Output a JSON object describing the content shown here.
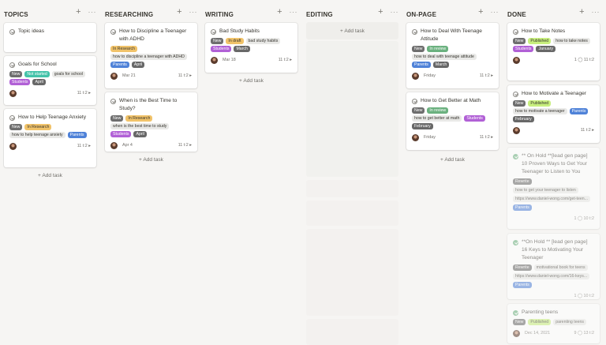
{
  "columns": [
    {
      "title": "TOPICS",
      "add_task": "+ Add task",
      "cards": [
        {
          "title": "Topic ideas"
        },
        {
          "title": "Goals for School",
          "tags": [
            {
              "t": "New"
            },
            {
              "t": "Not started"
            },
            {
              "t": "goals for school"
            },
            {
              "t": "Students"
            },
            {
              "t": "April"
            }
          ],
          "date": "",
          "time": "11 t:2 ▸"
        },
        {
          "title": "How to Help Teenage Anxiety",
          "tags": [
            {
              "t": "New"
            },
            {
              "t": "In Research"
            },
            {
              "t": "how to help teenage anxiety"
            },
            {
              "t": "Parents"
            }
          ],
          "date": "",
          "time": "11 t:2 ▸"
        }
      ]
    },
    {
      "title": "RESEARCHING",
      "add_task": "+ Add task",
      "cards": [
        {
          "title": "How to Discipline a Teenager with ADHD",
          "tags": [
            {
              "t": "In Research"
            },
            {
              "t": "how to discipline a teenager with ADHD"
            },
            {
              "t": "Parents"
            },
            {
              "t": "April"
            }
          ],
          "date": "Mar 21",
          "time": "11 t:2 ▸"
        },
        {
          "title": "When is the Best Time to Study?",
          "tags": [
            {
              "t": "New"
            },
            {
              "t": "In Research"
            },
            {
              "t": "when is the best time to study"
            },
            {
              "t": "Students"
            },
            {
              "t": "April"
            }
          ],
          "date": "Apr 4",
          "time": "11 t:2 ▸"
        }
      ]
    },
    {
      "title": "WRITING",
      "add_task": "+ Add task",
      "cards": [
        {
          "title": "Bad Study Habits",
          "tags": [
            {
              "t": "New"
            },
            {
              "t": "In draft"
            },
            {
              "t": "bad study habits"
            },
            {
              "t": "Students"
            },
            {
              "t": "March"
            }
          ],
          "date": "Mar 18",
          "time": "11 t:2 ▸"
        }
      ]
    },
    {
      "title": "EDITING",
      "add_task": "+ Add task",
      "cards": []
    },
    {
      "title": "ON-PAGE",
      "add_task": "+ Add task",
      "cards": [
        {
          "title": "How to Deal With Teenage Attitude",
          "tags": [
            {
              "t": "New"
            },
            {
              "t": "In review"
            },
            {
              "t": "how to deal with teenage attitude"
            },
            {
              "t": "Parents"
            },
            {
              "t": "March"
            }
          ],
          "date": "Friday",
          "time": "11 t:2 ▸"
        },
        {
          "title": "How to Get Better at Math",
          "tags": [
            {
              "t": "New"
            },
            {
              "t": "In review"
            },
            {
              "t": "how to get better at math"
            },
            {
              "t": "Students"
            },
            {
              "t": "February"
            }
          ],
          "date": "Friday",
          "time": "11 t:2 ▸"
        }
      ]
    },
    {
      "title": "DONE",
      "add_task": "+ Add task",
      "cards": [
        {
          "title": "How to Take Notes",
          "tags": [
            {
              "t": "New"
            },
            {
              "t": "Published"
            },
            {
              "t": "how to take notes"
            },
            {
              "t": "Students"
            },
            {
              "t": "January"
            }
          ],
          "date": "",
          "time": "1 ◯ 11 t:2"
        },
        {
          "title": "How to Motivate a Teenager",
          "tags": [
            {
              "t": "New"
            },
            {
              "t": "Published"
            },
            {
              "t": "how to motivate a teenager"
            },
            {
              "t": "Parents"
            },
            {
              "t": "February"
            }
          ],
          "date": "",
          "time": "11 t:2 ▸"
        },
        {
          "title": "** On Hold **[lead gen page] 10 Proven Ways to Get Your Teenager to Listen to You",
          "tags": [
            {
              "t": "Rewrite"
            },
            {
              "t": "how to get your teenager to listen"
            },
            {
              "t": "https://www.daniel-wong.com/get-teen..."
            },
            {
              "t": "Parents"
            }
          ],
          "date": "",
          "time": "1 ◯ 10 t:2"
        },
        {
          "title": "**On Hold ** [lead gen page] 16 Keys to Motivating Your Teenager",
          "tags": [
            {
              "t": "Rewrite"
            },
            {
              "t": "motivational book for teens"
            },
            {
              "t": "https://www.daniel-wong.com/16-keys..."
            },
            {
              "t": "Parents"
            }
          ],
          "date": "",
          "time": "1 ◯ 10 t:2"
        },
        {
          "title": "Parenting teens",
          "tags": [
            {
              "t": "New"
            },
            {
              "t": "Published"
            },
            {
              "t": "parenting teens"
            }
          ],
          "date": "Dec 14, 2021",
          "time": "9 ◯ 13 t:2"
        }
      ]
    }
  ]
}
